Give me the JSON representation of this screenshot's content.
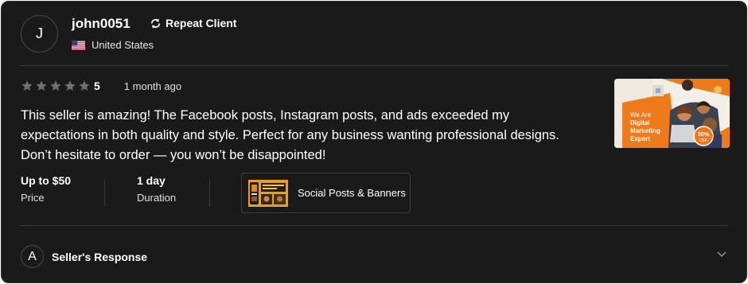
{
  "reviewer": {
    "initial": "J",
    "username": "john0051",
    "badge": "Repeat Client",
    "badge_icon": "repeat-icon",
    "country": "United States",
    "country_flag": "us-flag-icon"
  },
  "rating": {
    "stars_total": 5,
    "stars_filled": 5,
    "value": "5",
    "time_ago": "1 month ago"
  },
  "review": {
    "text": "This seller is amazing! The Facebook posts, Instagram posts, and ads exceeded my expectations in both quality and style. Perfect for any business wanting professional designs. Don’t hesitate to order — you won’t be disappointed!"
  },
  "meta": {
    "price_value": "Up to $50",
    "price_label": "Price",
    "duration_value": "1 day",
    "duration_label": "Duration"
  },
  "gig": {
    "title": "Social Posts & Banners"
  },
  "preview": {
    "text_line1": "We Are",
    "text_line2": "Digital",
    "text_line3": "Marketing",
    "text_line4": "Expert",
    "badge_value": "50%",
    "badge_label": "OFF"
  },
  "seller_response": {
    "initial": "A",
    "label": "Seller's Response"
  },
  "colors": {
    "card_bg": "#1a1a1a",
    "star": "#6f6f6f",
    "accent_orange": "#f07a1a"
  }
}
